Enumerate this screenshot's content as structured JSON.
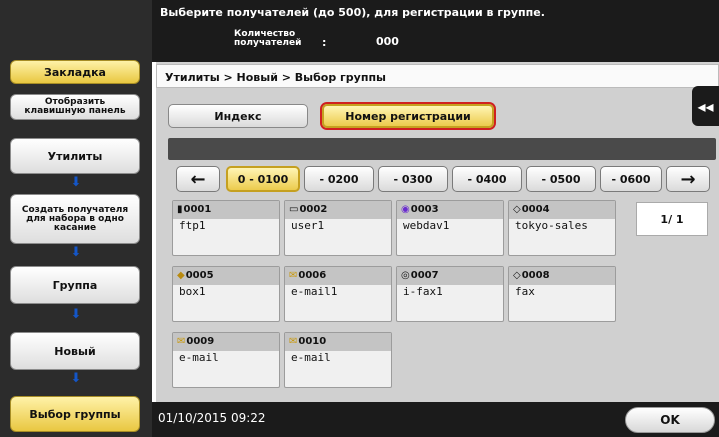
{
  "header": {
    "message": "Выберите получателей (до 500), для регистрации в группе.",
    "count_label": "Количество получателей",
    "colon": ":",
    "count_value": "000"
  },
  "left_panel": {
    "bookmark": "Закладка",
    "show_keypad": "Отобразить клавишную панель",
    "utilities": "Утилиты",
    "create_recipient": "Создать получателя для набора в одно касание",
    "group": "Группа",
    "new": "Новый",
    "select_group": "Выбор группы",
    "arrow_icon": "arrow-down-icon"
  },
  "breadcrumb": "Утилиты > Новый > Выбор группы",
  "tabs": {
    "index": "Индекс",
    "reg_number": "Номер регистрации"
  },
  "ranges": {
    "prev": "←",
    "next": "→",
    "items": [
      "0 - 0100",
      "- 0200",
      "- 0300",
      "- 0400",
      "- 0500",
      "- 0600"
    ]
  },
  "destinations": [
    {
      "num": "0001",
      "name": "ftp1",
      "icon": "ftp-icon",
      "glyph": "▮"
    },
    {
      "num": "0002",
      "name": "user1",
      "icon": "user-box-icon",
      "glyph": "▭"
    },
    {
      "num": "0003",
      "name": "webdav1",
      "icon": "webdav-icon",
      "glyph": "◉"
    },
    {
      "num": "0004",
      "name": "tokyo-sales",
      "icon": "smb-icon",
      "glyph": "◇"
    },
    {
      "num": "0005",
      "name": "box1",
      "icon": "box-icon",
      "glyph": "◆"
    },
    {
      "num": "0006",
      "name": "e-mail1",
      "icon": "email-icon",
      "glyph": "✉"
    },
    {
      "num": "0007",
      "name": "i-fax1",
      "icon": "ifax-icon",
      "glyph": "◎"
    },
    {
      "num": "0008",
      "name": "fax",
      "icon": "fax-icon",
      "glyph": "◇"
    },
    {
      "num": "0009",
      "name": "e-mail",
      "icon": "email-icon",
      "glyph": "✉"
    },
    {
      "num": "0010",
      "name": "e-mail",
      "icon": "email-icon",
      "glyph": "✉"
    }
  ],
  "page_indicator": "1/  1",
  "footer": {
    "datetime": "01/10/2015  09:22",
    "ok": "OK"
  },
  "side_handle": "◂◂",
  "colors": {
    "accent_yellow": "#eccb4d",
    "highlight_red": "#d02020",
    "arrow_blue": "#1456c8"
  }
}
